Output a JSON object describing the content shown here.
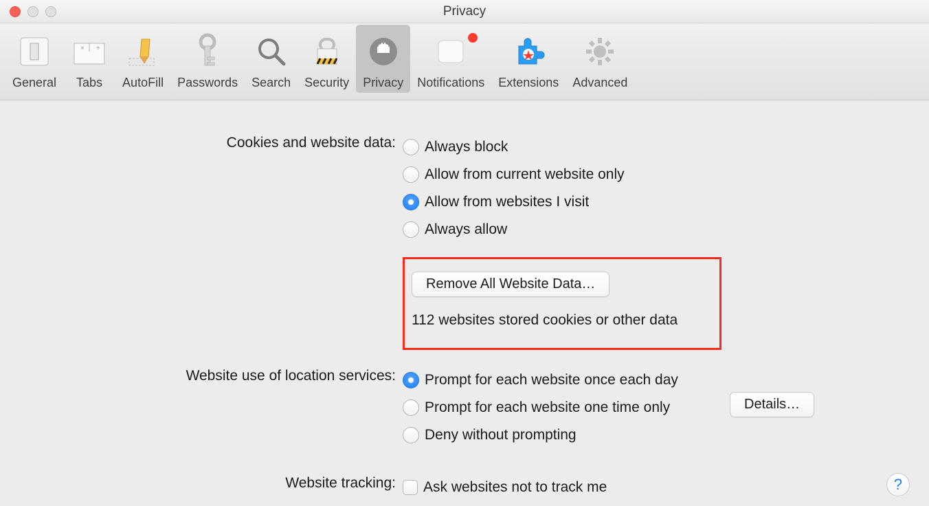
{
  "window": {
    "title": "Privacy"
  },
  "toolbar": {
    "items": [
      {
        "id": "general",
        "label": "General"
      },
      {
        "id": "tabs",
        "label": "Tabs"
      },
      {
        "id": "autofill",
        "label": "AutoFill"
      },
      {
        "id": "passwords",
        "label": "Passwords"
      },
      {
        "id": "search",
        "label": "Search"
      },
      {
        "id": "security",
        "label": "Security"
      },
      {
        "id": "privacy",
        "label": "Privacy",
        "active": true
      },
      {
        "id": "notifications",
        "label": "Notifications",
        "badge": true
      },
      {
        "id": "extensions",
        "label": "Extensions"
      },
      {
        "id": "advanced",
        "label": "Advanced"
      }
    ]
  },
  "cookies": {
    "section_label": "Cookies and website data:",
    "options": [
      "Always block",
      "Allow from current website only",
      "Allow from websites I visit",
      "Always allow"
    ],
    "selected_index": 2,
    "remove_all_label": "Remove All Website Data…",
    "stored_text": "112 websites stored cookies or other data",
    "details_label": "Details…"
  },
  "location": {
    "section_label": "Website use of location services:",
    "options": [
      "Prompt for each website once each day",
      "Prompt for each website one time only",
      "Deny without prompting"
    ],
    "selected_index": 0
  },
  "tracking": {
    "section_label": "Website tracking:",
    "checkbox_label": "Ask websites not to track me",
    "checked": false
  },
  "help": {
    "label": "?"
  },
  "annotation": {
    "highlight_box": true
  }
}
